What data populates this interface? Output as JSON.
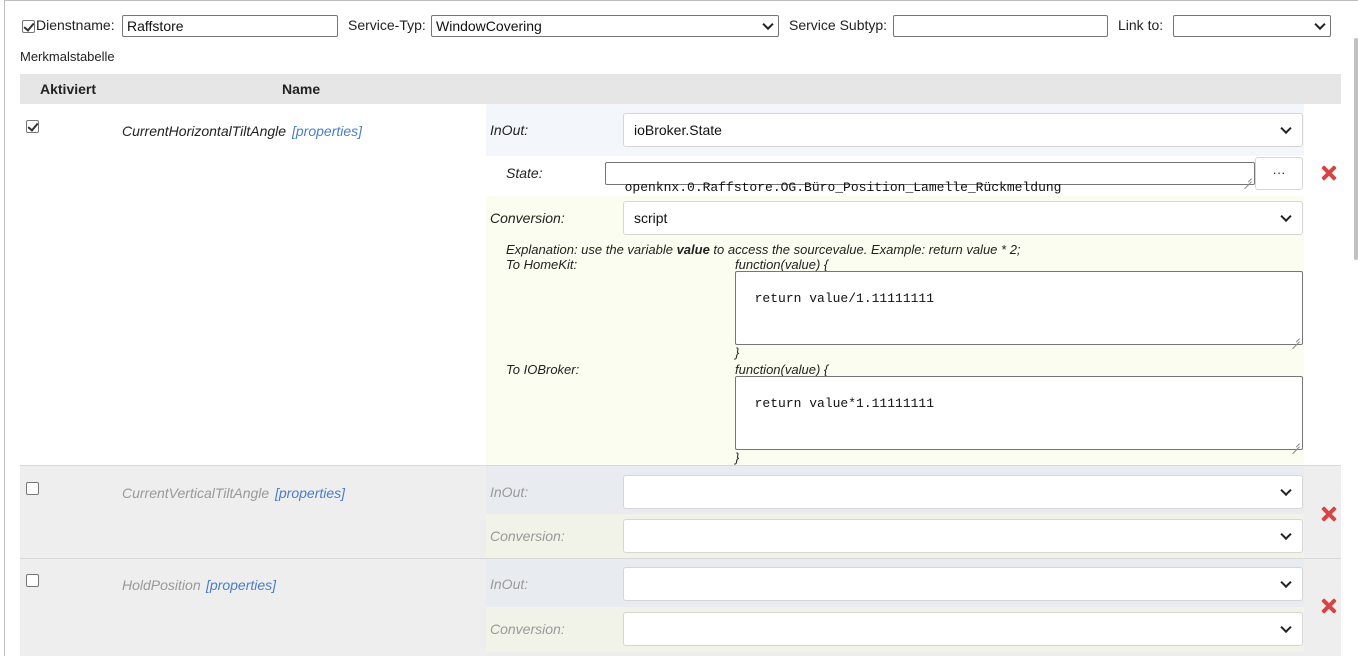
{
  "header": {
    "service_name_label": "Dienstname:",
    "service_name_value": "Raffstore",
    "service_type_label": "Service-Typ:",
    "service_type_value": "WindowCovering",
    "service_subtype_label": "Service Subtyp:",
    "service_subtype_value": "",
    "link_to_label": "Link to:",
    "link_to_value": ""
  },
  "table": {
    "title": "Merkmalstabelle",
    "col_active": "Aktiviert",
    "col_name": "Name"
  },
  "rows": [
    {
      "checked": true,
      "name": "CurrentHorizontalTiltAngle",
      "properties_link": "[properties]",
      "inout_label": "InOut:",
      "inout_value": "ioBroker.State",
      "state_label": "State:",
      "state_value": "openknx.0.Raffstore.OG.Büro_Position_Lamelle_Rückmeldung",
      "browse_label": "···",
      "conversion_label": "Conversion:",
      "conversion_value": "script",
      "explanation_prefix": "Explanation: use the variable ",
      "explanation_keyword": "value",
      "explanation_suffix": " to access the sourcevalue. Example: return value * 2;",
      "to_homekit_label": "To HomeKit:",
      "to_homekit_func_open": "function(value) {",
      "to_homekit_code": "return value/1.11111111",
      "to_homekit_func_close": "}",
      "to_iobroker_label": "To IOBroker:",
      "to_iobroker_func_open": "function(value) {",
      "to_iobroker_code": "return value*1.11111111",
      "to_iobroker_func_close": "}"
    },
    {
      "checked": false,
      "name": "CurrentVerticalTiltAngle",
      "properties_link": "[properties]",
      "inout_label": "InOut:",
      "inout_value": "",
      "conversion_label": "Conversion:",
      "conversion_value": ""
    },
    {
      "checked": false,
      "name": "HoldPosition",
      "properties_link": "[properties]",
      "inout_label": "InOut:",
      "inout_value": "",
      "conversion_label": "Conversion:",
      "conversion_value": ""
    }
  ],
  "colors": {
    "header_bg": "#e6e6e6",
    "inout_bg": "#f3f7fc",
    "conversion_bg": "#fbfdf0",
    "inactive_row_bg": "#eeeeee",
    "remove_icon": "#d64545",
    "link": "#4a7cc8"
  }
}
